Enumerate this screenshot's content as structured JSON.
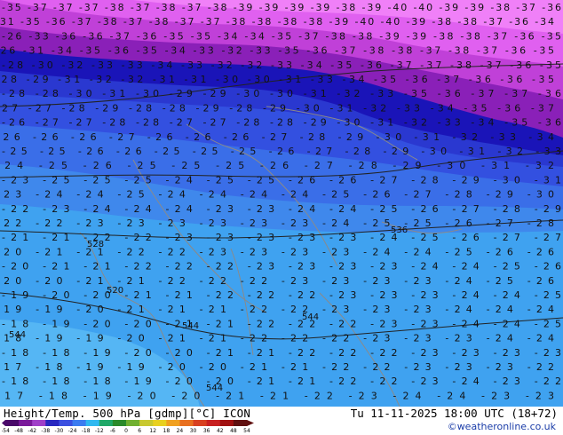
{
  "map": {
    "title_left": "Height/Temp. 500 hPa [gdmp][°C] ICON",
    "title_right": "Tu 11-11-2025 18:00 UTC (18+72)",
    "credit": "©weatheronline.co.uk",
    "scale_ticks": [
      "-54",
      "-48",
      "-42",
      "-38",
      "-30",
      "-24",
      "-18",
      "-12",
      "-6",
      "0",
      "6",
      "12",
      "18",
      "24",
      "30",
      "36",
      "42",
      "48",
      "54"
    ],
    "scale_colors": [
      "#4a0a6a",
      "#7a1a9a",
      "#a040c8",
      "#2828c0",
      "#3c50e0",
      "#3c7cf0",
      "#30b8f0",
      "#20a868",
      "#2a8a2a",
      "#70b030",
      "#c8c830",
      "#e8d020",
      "#f0a020",
      "#e87020",
      "#d84020",
      "#c82020",
      "#a01010",
      "#601010"
    ],
    "contour_labels": [
      {
        "row": 0,
        "text": "-35 -37 -37 -37 -38 -37 -38 -37 -38 -39 -39 -39 -39 -38 -39 -40 -40 -39 -39 -38 -37 -36"
      },
      {
        "row": 1,
        "text": "-31 -35 -36 -37 -38 -37 -38 -37 -37 -38 -38 -38 -38 -39 -40 -40 -39 -38 -38 -37 -36 -34"
      },
      {
        "row": 2,
        "text": "-26 -33 -36 -36 -37 -36 -35 -35 -34 -34 -35 -37 -38 -38 -39 -39 -38 -38 -37 -36 -35"
      },
      {
        "row": 3,
        "text": "-26 -31 -34 -35 -36 -35 -34 -33 -32 -33 -35 -36 -37 -38 -38 -37 -38 -37 -36 -35"
      },
      {
        "row": 4,
        "text": "-28 -30 -32 -33 -33 -34 -33 -32 -32 -33 -34 -35 -36 -37 -37 -38 -37 -36 -35"
      },
      {
        "row": 5,
        "text": "-28 -29 -31 -32 -32 -31 -31 -30 -30 -31 -33 -34 -35 -36 -37 -36 -36 -35"
      },
      {
        "row": 6,
        "text": "-28 -28 -30 -31 -30 -29 -29 -30 -30 -31 -32 -33 -35 -36 -37 -37 -36"
      },
      {
        "row": 7,
        "text": "-27 -27 -28 -29 -28 -28 -29 -28 -29 -30 -31 -32 -33 -34 -35 -36 -37"
      },
      {
        "row": 8,
        "text": "-26 -27 -27 -28 -28 -27 -27 -28 -28 -29 -30 -31 -32 -33 -34 -35 -36"
      },
      {
        "row": 9,
        "text": "-26 -26 -26 -27 -26 -26 -26 -27 -28 -29 -30 -31 -32 -33 -34"
      },
      {
        "row": 10,
        "text": "-25 -25 -26 -26 -25 -25 -25 -26 -27 -28 -29 -30 -31 -32 -33"
      },
      {
        "row": 11,
        "text": "-24 -25 -26 -25 -25 -25 -26 -27 -28 -29 -30 -31 -32"
      },
      {
        "row": 12,
        "text": "-23 -25 -25 -25 -24 -25 -25 -26 -26 -27 -28 -29 -30 -31"
      },
      {
        "row": 13,
        "text": "-23 -24 -24 -25 -24 -24 -24 -24 -25 -26 -27 -28 -29 -30"
      },
      {
        "row": 14,
        "text": "-22 -23 -24 -24 -24 -23 -23 -24 -24 -25 -26 -27 -28 -29"
      },
      {
        "row": 15,
        "text": "-22 -22 -23 -23 -23 -23 -23 -23 -24 -25 -25 -26 -27 -28"
      },
      {
        "row": 16,
        "text": "-21 -21 -22 -22 -23 -23 -23 -23 -23 -24 -25 -26 -27 -27"
      },
      {
        "row": 17,
        "text": "-20 -21 -21 -22 -22 -23 -23 -23 -23 -24 -24 -25 -26 -26"
      },
      {
        "row": 18,
        "text": "-20 -21 -21 -22 -22 -22 -23 -23 -23 -23 -24 -24 -25 -26"
      },
      {
        "row": 19,
        "text": "-20 -20 -21 -21 -22 -22 -22 -23 -23 -23 -23 -24 -25 -26"
      },
      {
        "row": 20,
        "text": "-19 -20 -20 -21 -21 -22 -22 -22 -23 -23 -23 -24 -24 -25"
      },
      {
        "row": 21,
        "text": "-19 -19 -20 -21 -21 -21 -22 -22 -23 -23 -23 -24 -24 -24"
      },
      {
        "row": 22,
        "text": "-18 -19 -20 -20 -21 -21 -22 -22 -22 -23 -23 -24 -24 -25"
      },
      {
        "row": 23,
        "text": "-18 -19 -19 -20 -21 -21 -22 -22 -22 -23 -23 -23 -24 -24"
      },
      {
        "row": 24,
        "text": "-18 -18 -19 -20 -20 -21 -21 -22 -22 -22 -23 -23 -23 -23"
      },
      {
        "row": 25,
        "text": "-17 -18 -19 -19 -20 -20 -21 -21 -22 -22 -23 -23 -23 -22"
      },
      {
        "row": 26,
        "text": "-18 -18 -18 -19 -20 -20 -21 -21 -22 -22 -23 -24 -23 -22"
      },
      {
        "row": 27,
        "text": "-17 -18 -19 -20 -20 -21 -21 -22 -23 -24 -24 -23 -23"
      }
    ],
    "height_labels": [
      "544",
      "536",
      "528",
      "520",
      "544",
      "544",
      "544"
    ]
  }
}
